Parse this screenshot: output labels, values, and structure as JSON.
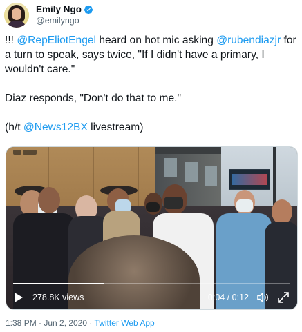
{
  "author": {
    "display_name": "Emily Ngo",
    "handle": "@emilyngo",
    "verified": true,
    "avatar_icon": "avatar-photo"
  },
  "tweet": {
    "p1_a": "!!! ",
    "p1_mention1": "@RepEliotEngel",
    "p1_b": " heard on hot mic asking ",
    "p1_mention2": "@rubendiazjr",
    "p1_c": " for a turn to speak, says twice, \"If I didn't have a primary, I wouldn't care.\"",
    "p2": "Diaz responds, \"Don't do that to me.\"",
    "p3_a": "(h/t ",
    "p3_mention": "@News12BX",
    "p3_b": " livestream)"
  },
  "video": {
    "views": "278.8K views",
    "time": "0:04 / 0:12",
    "progress": 0.33,
    "play_icon": "play-icon",
    "volume_icon": "volume-icon",
    "fullscreen_icon": "fullscreen-icon"
  },
  "footer": {
    "time_date": "1:38 PM · Jun 2, 2020 · ",
    "app": "Twitter Web App"
  },
  "colors": {
    "link": "#1d9bf0",
    "muted": "#536471",
    "text": "#0f1419"
  }
}
